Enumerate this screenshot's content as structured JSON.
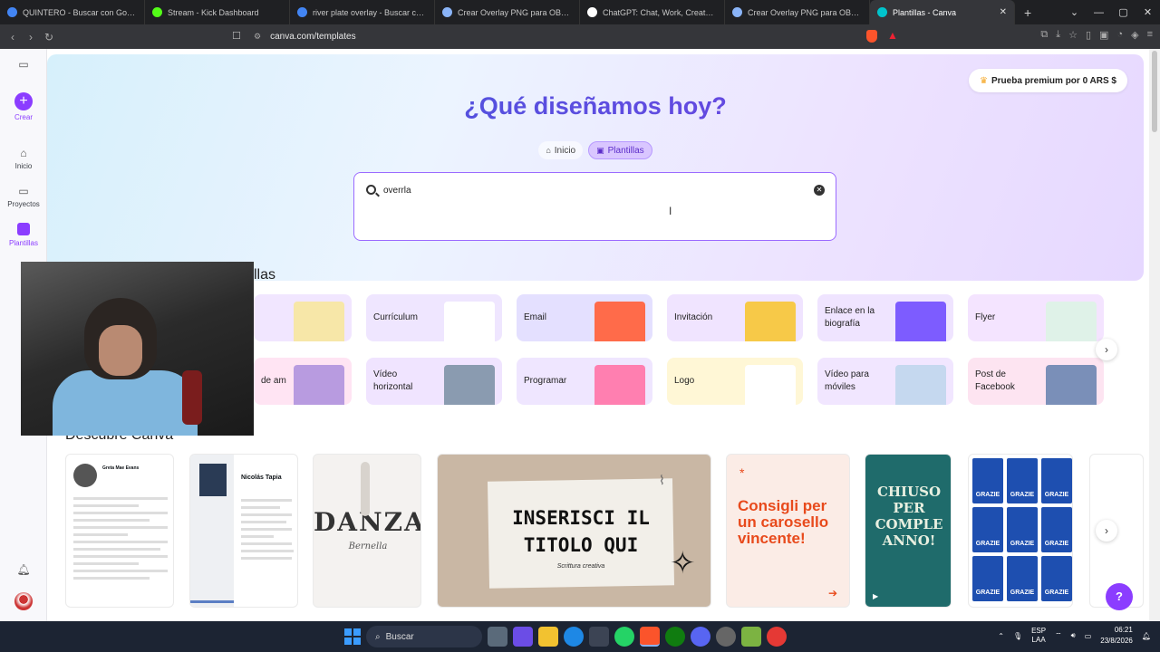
{
  "browser": {
    "tabs": [
      {
        "title": "QUINTERO - Buscar con Google",
        "color": "#4285f4"
      },
      {
        "title": "Stream - Kick Dashboard",
        "color": "#53fc18"
      },
      {
        "title": "river plate overlay - Buscar con Goo",
        "color": "#4285f4"
      },
      {
        "title": "Crear Overlay PNG para OBS - Goo",
        "color": "#8ab4f8"
      },
      {
        "title": "ChatGPT: Chat, Work, Create & Co",
        "color": "#ffffff"
      },
      {
        "title": "Crear Overlay PNG para OBS - Goo",
        "color": "#8ab4f8"
      },
      {
        "title": "Plantillas - Canva",
        "color": "#00c4cc",
        "active": true
      }
    ],
    "new_tab_label": "+",
    "url": "canva.com/templates"
  },
  "sidebar": {
    "items": [
      {
        "label": "Crear"
      },
      {
        "label": "Inicio"
      },
      {
        "label": "Proyectos"
      },
      {
        "label": "Plantillas"
      }
    ]
  },
  "main": {
    "premium_label": "Prueba premium por 0 ARS $",
    "title": "¿Qué diseñamos hoy?",
    "pills": [
      {
        "label": "Inicio"
      },
      {
        "label": "Plantillas"
      }
    ],
    "search": {
      "value": "overrla",
      "placeholder": ""
    },
    "section_templates": "llas",
    "categories_row1": [
      {
        "label": "",
        "color": "#f1e6ff"
      },
      {
        "label": "Currículum",
        "color": "#efe6ff"
      },
      {
        "label": "Email",
        "color": "#e4e0ff"
      },
      {
        "label": "Invitación",
        "color": "#f0e4ff"
      },
      {
        "label": "Enlace en la biografía",
        "color": "#efe4ff"
      },
      {
        "label": "Flyer",
        "color": "#f4e4ff"
      }
    ],
    "categories_row2": [
      {
        "label": "de am",
        "color": "#ffe4f3"
      },
      {
        "label": "Vídeo horizontal",
        "color": "#f0e4ff"
      },
      {
        "label": "Programar",
        "color": "#efe6ff"
      },
      {
        "label": "Logo",
        "color": "#fff7d6"
      },
      {
        "label": "Vídeo para móviles",
        "color": "#f1e6ff"
      },
      {
        "label": "Post de Facebook",
        "color": "#fde4f1"
      }
    ],
    "section_discover": "Descubre Canva",
    "cards": {
      "resume1_name": "Greta Mae Evans",
      "resume2_name": "Nicolás Tapia",
      "dance_title": "DANZA",
      "dance_sub": "Bernella",
      "note_title": "INSERISCI IL TITOLO QUI",
      "note_sub": "Scrittura creativa",
      "carousel_text": "Consigli per un carosello vincente!",
      "chiuso_text": "CHIUSO PER COMPLE ANNO!",
      "grazie_label": "GRAZIE"
    },
    "help_label": "?"
  },
  "taskbar": {
    "search_label": "Buscar",
    "lang_line1": "ESP",
    "lang_line2": "LAA",
    "time": "06:21",
    "date": "23/8/2026"
  }
}
